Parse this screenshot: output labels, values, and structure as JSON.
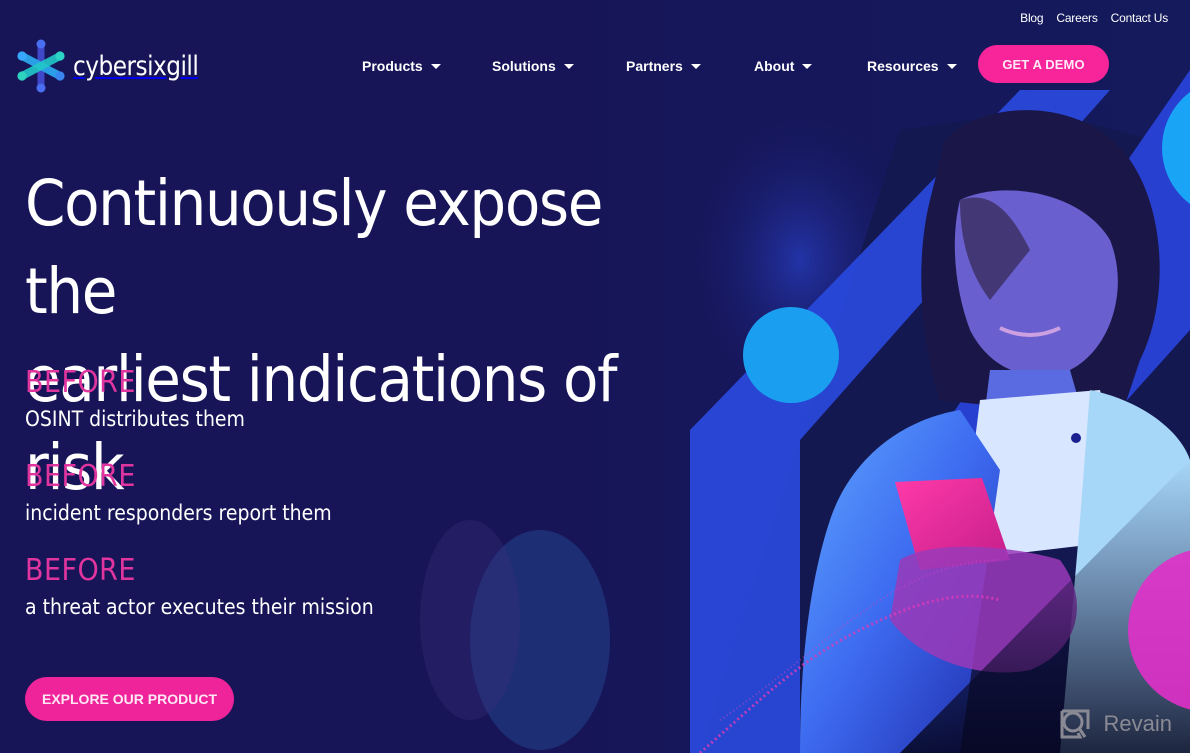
{
  "brand": {
    "name": "cybersixgill",
    "logo_icon": "asterisk-x-logo-icon",
    "colors": {
      "background": "#171558",
      "accent_pink": "#f7249a",
      "before_pink": "#e0359e",
      "shape_blue": "#2a4ae0",
      "circle_cyan": "#1aa0f0"
    }
  },
  "utility_nav": [
    {
      "label": "Blog"
    },
    {
      "label": "Careers"
    },
    {
      "label": "Contact Us"
    }
  ],
  "main_nav": [
    {
      "label": "Products",
      "icon": "caret-down-icon"
    },
    {
      "label": "Solutions",
      "icon": "caret-down-icon"
    },
    {
      "label": "Partners",
      "icon": "caret-down-icon"
    },
    {
      "label": "About",
      "icon": "caret-down-icon"
    },
    {
      "label": "Resources",
      "icon": "caret-down-icon"
    }
  ],
  "cta_demo": {
    "label": "GET A DEMO"
  },
  "hero": {
    "headline_line1": "Continuously expose the",
    "headline_line2": "earliest indications of risk",
    "before_items": [
      {
        "label": "BEFORE",
        "text": "OSINT distributes them"
      },
      {
        "label": "BEFORE",
        "text": "incident responders report them"
      },
      {
        "label": "BEFORE",
        "text": "a threat actor executes their mission"
      }
    ],
    "cta_explore": {
      "label": "EXPLORE OUR PRODUCT"
    },
    "image_alt": "woman smiling while looking at a glowing phone"
  },
  "watermark": {
    "label": "Revain",
    "icon": "revain-logo-icon"
  }
}
